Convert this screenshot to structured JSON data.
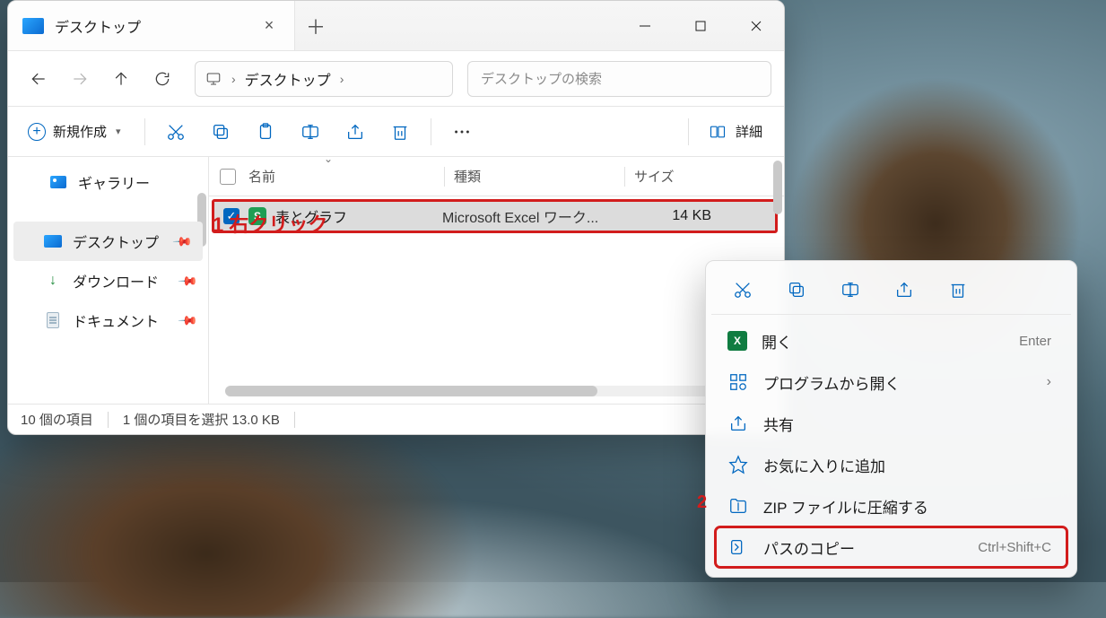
{
  "tab": {
    "title": "デスクトップ"
  },
  "breadcrumb": {
    "segment": "デスクトップ"
  },
  "search": {
    "placeholder": "デスクトップの検索"
  },
  "toolbar": {
    "new_label": "新規作成",
    "details_label": "詳細"
  },
  "columns": {
    "name": "名前",
    "type": "種類",
    "size": "サイズ"
  },
  "file": {
    "name": "表とグラフ",
    "type": "Microsoft Excel ワーク...",
    "size": "14 KB"
  },
  "sidebar": {
    "gallery": "ギャラリー",
    "desktop": "デスクトップ",
    "downloads": "ダウンロード",
    "documents": "ドキュメント"
  },
  "status": {
    "count": "10 個の項目",
    "selection": "1 個の項目を選択 13.0 KB"
  },
  "annotations": {
    "a1": "1 右クリック",
    "a2": "2"
  },
  "contextmenu": {
    "open": {
      "label": "開く",
      "accel": "Enter"
    },
    "openwith": {
      "label": "プログラムから開く"
    },
    "share": {
      "label": "共有"
    },
    "favorite": {
      "label": "お気に入りに追加"
    },
    "zip": {
      "label": "ZIP ファイルに圧縮する"
    },
    "copypath": {
      "label": "パスのコピー",
      "accel": "Ctrl+Shift+C"
    }
  }
}
